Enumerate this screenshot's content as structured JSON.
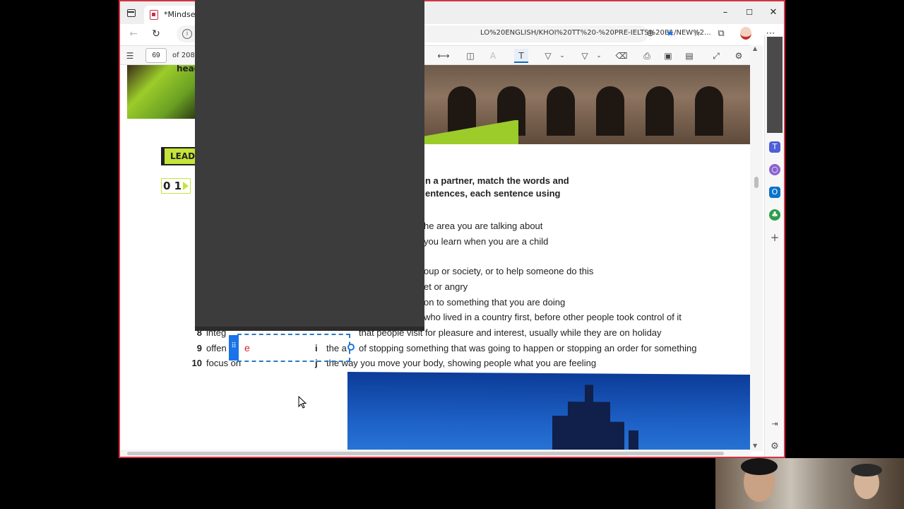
{
  "browser": {
    "tab_title": "*Mindset fo",
    "url": "LO%20ENGLISH/KHOI%20TT%20-%20PRE-IELTS%20B1/NEW%2...",
    "window_controls": {
      "minimize": "–",
      "maximize": "☐",
      "close": "✕"
    },
    "icons": [
      "tab-manager-icon",
      "back-icon",
      "refresh-icon",
      "info-icon",
      "zoom-icon",
      "favorite-star-icon",
      "collections-icon",
      "tab-icon",
      "profile-avatar",
      "more-icon"
    ]
  },
  "pdf_toolbar": {
    "page_current": "69",
    "page_total": "of 208"
  },
  "document": {
    "left_image_text": "head",
    "lead_badge": "LEAD-",
    "exercise_badge": "0 1",
    "instruction_line1": "n a partner, match the words and",
    "instruction_line2": "entences, each sentence using",
    "items": [
      {
        "text": "he area you are talking about"
      },
      {
        "text": "you learn when you are a child"
      },
      {
        "text": "oup or society, or to help someone do this"
      },
      {
        "text": "et or angry"
      },
      {
        "text": "on to something that you are doing"
      },
      {
        "text": "who lived in a country first, before other people took control of it"
      }
    ],
    "row8": {
      "num": "8",
      "word": "integ",
      "letter": "",
      "def": "that people visit for pleasure and interest, usually while they are on holiday"
    },
    "row9": {
      "num": "9",
      "word": "offen",
      "answer": "e",
      "letter": "i",
      "def_start": "the a",
      "def": "of stopping something that was going to happen or stopping an order for something"
    },
    "row10": {
      "num": "10",
      "word": "focus on",
      "letter": "j",
      "def": "the way you move your body, showing people what you are feeling"
    }
  },
  "colors": {
    "window_border": "#d33240",
    "accent": "#0f6cbd",
    "lime": "#c4e538",
    "overlay": "#3c3c3c",
    "answer_red": "#d22222"
  }
}
